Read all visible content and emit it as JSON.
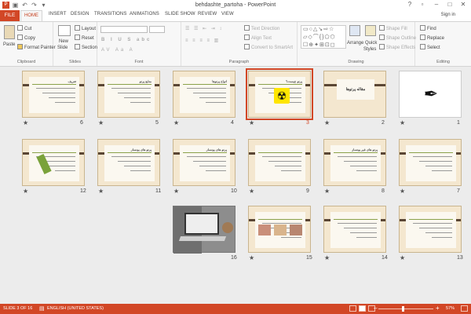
{
  "window": {
    "title": "behdashte_partoha - PowerPoint",
    "sign_in": "Sign in",
    "controls": {
      "help": "?",
      "restore": "▫",
      "minimize": "–",
      "maximize": "□",
      "close": "✕"
    }
  },
  "qat": [
    "save-icon",
    "undo-icon",
    "redo-icon",
    "customize-icon"
  ],
  "tabs": [
    "FILE",
    "HOME",
    "INSERT",
    "DESIGN",
    "TRANSITIONS",
    "ANIMATIONS",
    "SLIDE SHOW",
    "REVIEW",
    "VIEW"
  ],
  "ribbon": {
    "clipboard": {
      "label": "Clipboard",
      "paste": "Paste",
      "cut": "Cut",
      "copy": "Copy",
      "format_painter": "Format Painter"
    },
    "slides": {
      "label": "Slides",
      "new_slide": "New",
      "new_slide2": "Slide",
      "layout": "Layout",
      "reset": "Reset",
      "section": "Section"
    },
    "font": {
      "label": "Font"
    },
    "paragraph": {
      "label": "Paragraph",
      "text_direction": "Text Direction",
      "align_text": "Align Text",
      "convert": "Convert to SmartArt"
    },
    "drawing": {
      "label": "Drawing",
      "arrange": "Arrange",
      "quick_styles": "Quick",
      "quick_styles2": "Styles",
      "shape_fill": "Shape Fill",
      "shape_outline": "Shape Outline",
      "shape_effects": "Shape Effects"
    },
    "editing": {
      "label": "Editing",
      "find": "Find",
      "replace": "Replace",
      "select": "Select"
    }
  },
  "slides": [
    {
      "n": "1",
      "kind": "calligraphy"
    },
    {
      "n": "2",
      "kind": "titlebox",
      "title": "مقاله پرتوها"
    },
    {
      "n": "3",
      "kind": "radiation",
      "title": "پرتو چیست؟",
      "selected": true
    },
    {
      "n": "4",
      "kind": "list",
      "title": "انواع پرتوها"
    },
    {
      "n": "5",
      "kind": "list",
      "title": "منابع پرتو"
    },
    {
      "n": "6",
      "kind": "text",
      "title": "تعریف"
    },
    {
      "n": "7",
      "kind": "text",
      "title": ""
    },
    {
      "n": "8",
      "kind": "text",
      "title": "پرتو های غیر یونساز"
    },
    {
      "n": "9",
      "kind": "text",
      "title": ""
    },
    {
      "n": "10",
      "kind": "text",
      "title": "پرتو های یونساز"
    },
    {
      "n": "11",
      "kind": "text",
      "title": "پرتو های یونساز"
    },
    {
      "n": "12",
      "kind": "dna",
      "title": ""
    },
    {
      "n": "13",
      "kind": "text",
      "title": ""
    },
    {
      "n": "14",
      "kind": "text",
      "title": ""
    },
    {
      "n": "15",
      "kind": "photos",
      "title": ""
    },
    {
      "n": "16",
      "kind": "laptop",
      "title": ""
    }
  ],
  "status": {
    "slide": "SLIDE 3 OF 16",
    "language": "ENGLISH (UNITED STATES)",
    "zoom": "57%"
  }
}
